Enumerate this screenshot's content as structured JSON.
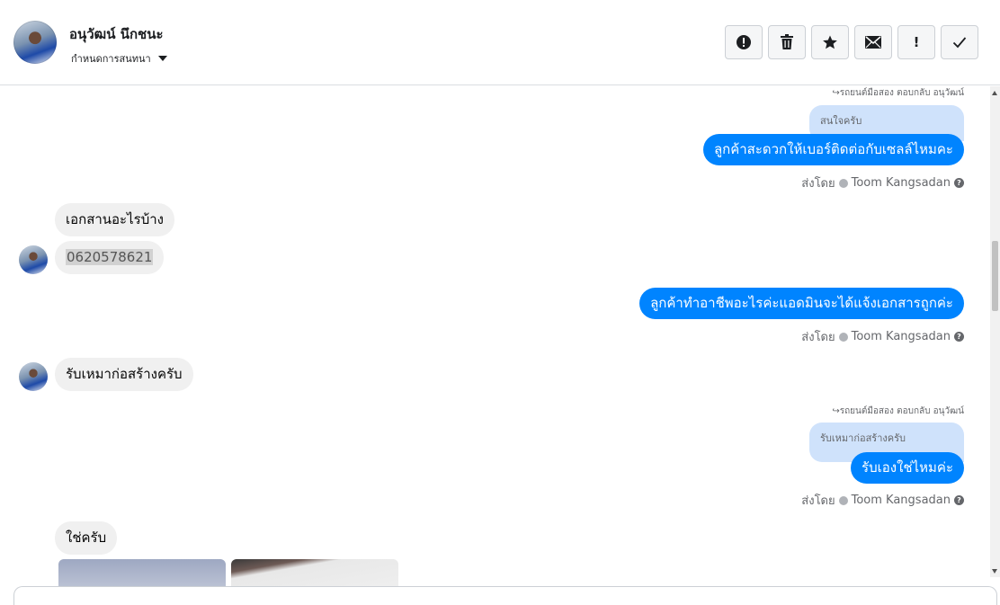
{
  "header": {
    "contact_name": "อนุวัฒน์ นึกชนะ",
    "assign_label": "กำหนดการสนทนา",
    "toolbar": [
      {
        "name": "report-button",
        "icon": "alert-circle-icon"
      },
      {
        "name": "delete-button",
        "icon": "trash-icon"
      },
      {
        "name": "star-button",
        "icon": "star-icon"
      },
      {
        "name": "mark-unread-button",
        "icon": "envelope-icon"
      },
      {
        "name": "priority-button",
        "icon": "exclamation-icon",
        "glyph": "!"
      },
      {
        "name": "mark-done-button",
        "icon": "checkmark-icon"
      }
    ]
  },
  "conversation": {
    "reply1": {
      "meta": "↪รถยนต์มือสอง ตอบกลับ อนุวัฒน์",
      "quote": "สนใจครับ",
      "text": "ลูกค้าสะดวกให้เบอร์ติดต่อกับเซลล์ไหมคะ",
      "sent_prefix": "ส่งโดย",
      "sender": "Toom Kangsadan"
    },
    "incoming1": {
      "text1": "เอกสานอะไรบ้าง",
      "text2": "0620578621"
    },
    "outgoing2": {
      "text": "ลูกค้าทำอาชีพอะไรค่ะแอดมินจะได้แจ้งเอกสารถูกค่ะ",
      "sent_prefix": "ส่งโดย",
      "sender": "Toom Kangsadan"
    },
    "incoming2": {
      "text": "รับเหมาก่อสร้างครับ"
    },
    "reply2": {
      "meta": "↪รถยนต์มือสอง ตอบกลับ อนุวัฒน์",
      "quote": "รับเหมาก่อสร้างครับ",
      "text": "รับเองใช่ไหมค่ะ",
      "sent_prefix": "ส่งโดย",
      "sender": "Toom Kangsadan"
    },
    "incoming3": {
      "text": "ใช่ครับ"
    }
  },
  "colors": {
    "outgoing_bubble": "#0084ff",
    "quote_bubble": "#cfe2fb",
    "incoming_bubble": "#f0f0f0"
  }
}
